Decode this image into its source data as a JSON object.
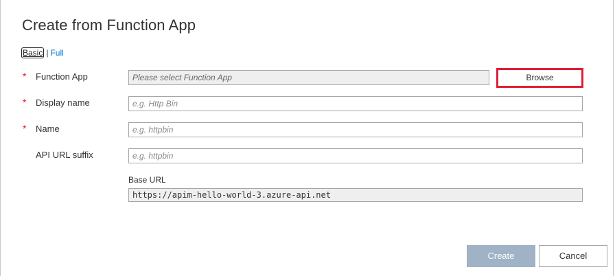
{
  "title": "Create from Function App",
  "mode": {
    "basic": "Basic",
    "separator": "|",
    "full": "Full"
  },
  "required_marker": "*",
  "fields": {
    "function_app": {
      "label": "Function App",
      "placeholder": "Please select Function App",
      "value": ""
    },
    "display_name": {
      "label": "Display name",
      "placeholder": "e.g. Http Bin",
      "value": ""
    },
    "name": {
      "label": "Name",
      "placeholder": "e.g. httpbin",
      "value": ""
    },
    "api_url_suffix": {
      "label": "API URL suffix",
      "placeholder": "e.g. httpbin",
      "value": ""
    }
  },
  "browse_label": "Browse",
  "base_url": {
    "label": "Base URL",
    "value": "https://apim-hello-world-3.azure-api.net"
  },
  "buttons": {
    "create": "Create",
    "cancel": "Cancel"
  },
  "colors": {
    "required": "#e81123",
    "link": "#0078d4",
    "highlight": "#e01e37",
    "create_disabled": "#9fb2c6"
  }
}
